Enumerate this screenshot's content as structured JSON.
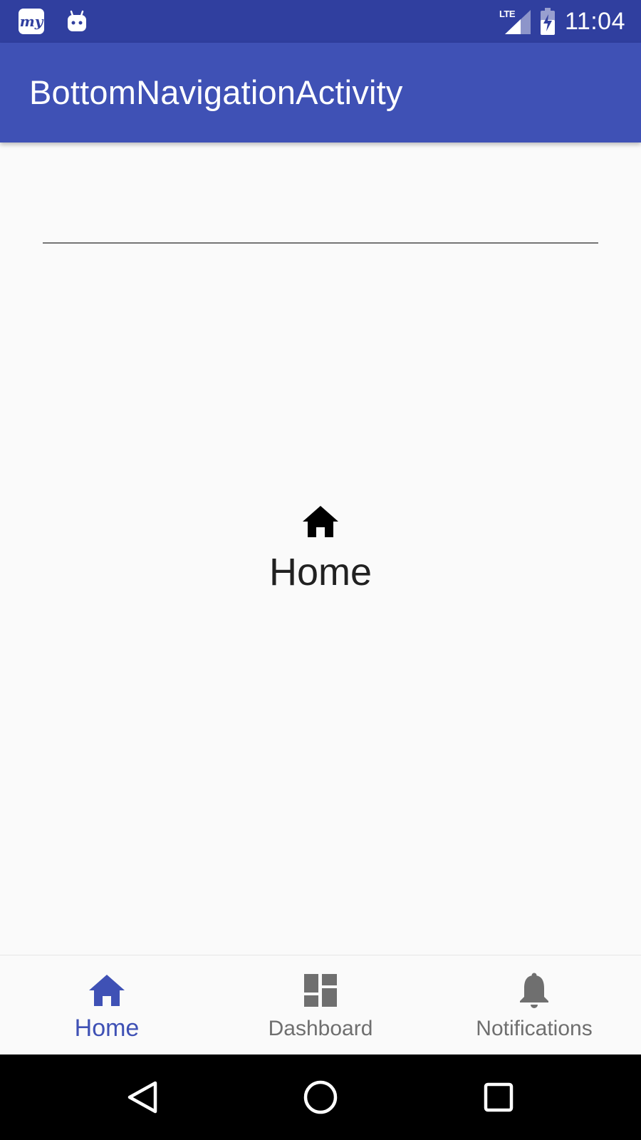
{
  "status_bar": {
    "app_icon_text": "my",
    "network_label": "LTE",
    "time": "11:04",
    "icons": [
      "my-app-icon",
      "android-robot-icon",
      "lte-signal-icon",
      "battery-charging-icon"
    ]
  },
  "app_bar": {
    "title": "BottomNavigationActivity"
  },
  "content": {
    "icon": "home-icon",
    "label": "Home"
  },
  "bottom_nav": {
    "accent_color": "#3f51b5",
    "inactive_color": "#6f6f6f",
    "items": [
      {
        "label": "Home",
        "icon": "home-icon",
        "selected": true
      },
      {
        "label": "Dashboard",
        "icon": "dashboard-icon",
        "selected": false
      },
      {
        "label": "Notifications",
        "icon": "bell-icon",
        "selected": false
      }
    ]
  },
  "system_nav": {
    "icons": [
      "back-icon",
      "home-circle-icon",
      "recents-icon"
    ]
  },
  "colors": {
    "status_bar": "#303f9f",
    "app_bar": "#3f51b5",
    "background": "#fafafa"
  }
}
